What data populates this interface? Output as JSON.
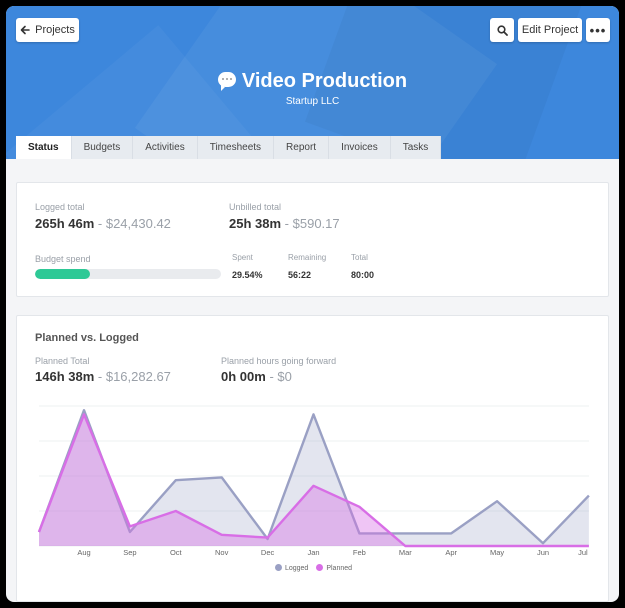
{
  "header": {
    "back_label": "Projects",
    "edit_label": "Edit Project",
    "more_label": "•••",
    "title": "Video Production",
    "client": "Startup LLC"
  },
  "tabs": [
    "Status",
    "Budgets",
    "Activities",
    "Timesheets",
    "Report",
    "Invoices",
    "Tasks"
  ],
  "summary": {
    "logged_label": "Logged total",
    "logged_hours": "265h 46m",
    "logged_amount": "$24,430.42",
    "unbilled_label": "Unbilled total",
    "unbilled_hours": "25h 38m",
    "unbilled_amount": "$590.17",
    "budget_label": "Budget spend",
    "budget_fraction": 0.2954,
    "spent_label": "Spent",
    "spent_value": "29.54%",
    "remaining_label": "Remaining",
    "remaining_value": "56:22",
    "total_label": "Total",
    "total_value": "80:00"
  },
  "planned": {
    "title": "Planned vs. Logged",
    "total_label": "Planned Total",
    "total_hours": "146h 38m",
    "total_amount": "$16,282.67",
    "forward_label": "Planned hours going forward",
    "forward_hours": "0h 00m",
    "forward_amount": "$0"
  },
  "colors": {
    "header": "#3d87dc",
    "logged": "#9aa0c4",
    "planned": "#d86ee6",
    "budget_bar": "#2ec996"
  },
  "chart_data": {
    "type": "area",
    "categories": [
      "Aug",
      "Sep",
      "Oct",
      "Nov",
      "Dec",
      "Jan",
      "Feb",
      "Mar",
      "Apr",
      "May",
      "Jun",
      "Jul"
    ],
    "x_start": [
      "Jul",
      0.0
    ],
    "points_x": [
      -1,
      0,
      1,
      2,
      3,
      4,
      5,
      6,
      7,
      8,
      9,
      10,
      11
    ],
    "series": [
      {
        "name": "Logged",
        "values": [
          10,
          97,
          10,
          47,
          49,
          5,
          94,
          9,
          9,
          9,
          32,
          2,
          36
        ]
      },
      {
        "name": "Planned",
        "values": [
          10,
          94,
          14,
          25,
          8,
          6,
          43,
          28,
          0,
          0,
          0,
          0,
          0
        ]
      }
    ],
    "ylim": [
      0,
      100
    ],
    "grid": true,
    "legend_position": "bottom-center"
  }
}
